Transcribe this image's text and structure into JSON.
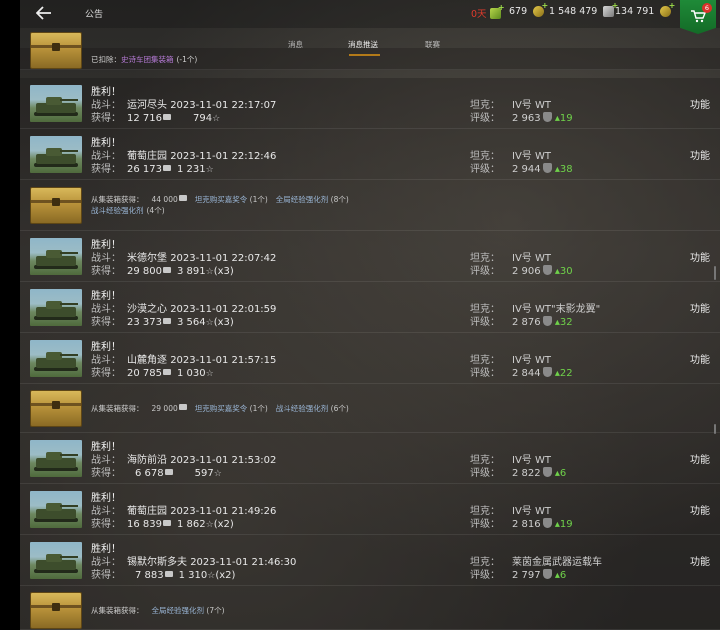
{
  "header": {
    "title": "公告",
    "gold": "0天",
    "gold_amount": "679",
    "silver": "1 548 479",
    "free_xp": "134 791",
    "shop_badge": "6"
  },
  "tabs": [
    {
      "label": "消息"
    },
    {
      "label": "消息推送"
    },
    {
      "label": "联赛"
    }
  ],
  "partial_row": {
    "text": "已扣除：",
    "item": "史诗车团集装箱",
    "count": "(-1个)"
  },
  "rows": [
    {
      "victory": "胜利！",
      "battle_label": "战斗：",
      "map": "运河尽头",
      "datetime": "2023-11-01 22:17:07",
      "reward_label": "获得：",
      "credits": "12 716",
      "xp": "794",
      "xp_mult": "",
      "tank_label": "坦克：",
      "tank": "IV号 WT",
      "rating_label": "评级：",
      "rating": "2 963",
      "delta": "19",
      "action": "功能"
    },
    {
      "victory": "胜利！",
      "battle_label": "战斗：",
      "map": "葡萄庄园",
      "datetime": "2023-11-01 22:12:46",
      "reward_label": "获得：",
      "credits": "26 173",
      "xp": "1 231",
      "xp_mult": "",
      "tank_label": "坦克：",
      "tank": "IV号 WT",
      "rating_label": "评级：",
      "rating": "2 944",
      "delta": "38",
      "action": "功能"
    },
    {
      "victory": "胜利！",
      "battle_label": "战斗：",
      "map": "米德尔堡",
      "datetime": "2023-11-01 22:07:42",
      "reward_label": "获得：",
      "credits": "29 800",
      "xp": "3 891",
      "xp_mult": "(x3)",
      "tank_label": "坦克：",
      "tank": "IV号 WT",
      "rating_label": "评级：",
      "rating": "2 906",
      "delta": "30",
      "action": "功能"
    },
    {
      "victory": "胜利！",
      "battle_label": "战斗：",
      "map": "沙漠之心",
      "datetime": "2023-11-01 22:01:59",
      "reward_label": "获得：",
      "credits": "23 373",
      "xp": "3 564",
      "xp_mult": "(x3)",
      "tank_label": "坦克：",
      "tank": "IV号 WT\"末影龙翼\"",
      "rating_label": "评级：",
      "rating": "2 876",
      "delta": "32",
      "action": "功能"
    },
    {
      "victory": "胜利！",
      "battle_label": "战斗：",
      "map": "山麓角逐",
      "datetime": "2023-11-01 21:57:15",
      "reward_label": "获得：",
      "credits": "20 785",
      "xp": "1 030",
      "xp_mult": "",
      "tank_label": "坦克：",
      "tank": "IV号 WT",
      "rating_label": "评级：",
      "rating": "2 844",
      "delta": "22",
      "action": "功能"
    },
    {
      "victory": "胜利！",
      "battle_label": "战斗：",
      "map": "海防前沿",
      "datetime": "2023-11-01 21:53:02",
      "reward_label": "获得：",
      "credits": "6 678",
      "xp": "597",
      "xp_mult": "",
      "tank_label": "坦克：",
      "tank": "IV号 WT",
      "rating_label": "评级：",
      "rating": "2 822",
      "delta": "6",
      "action": "功能"
    },
    {
      "victory": "胜利！",
      "battle_label": "战斗：",
      "map": "葡萄庄园",
      "datetime": "2023-11-01 21:49:26",
      "reward_label": "获得：",
      "credits": "16 839",
      "xp": "1 862",
      "xp_mult": "(x2)",
      "tank_label": "坦克：",
      "tank": "IV号 WT",
      "rating_label": "评级：",
      "rating": "2 816",
      "delta": "19",
      "action": "功能"
    },
    {
      "victory": "胜利！",
      "battle_label": "战斗：",
      "map": "锡默尔斯多夫",
      "datetime": "2023-11-01 21:46:30",
      "reward_label": "获得：",
      "credits": "7 883",
      "xp": "1 310",
      "xp_mult": "(x2)",
      "tank_label": "坦克：",
      "tank": "莱茵金属武器运载车",
      "rating_label": "评级：",
      "rating": "2 797",
      "delta": "6",
      "action": "功能"
    }
  ],
  "chest_rows": [
    {
      "prefix": "从集装箱获得：",
      "credits": "44 000",
      "item1": "坦克购买嘉奖令",
      "count1": "(1个)",
      "item2": "全局经验强化剂",
      "count2": "(8个)",
      "line2_item": "战斗经验强化剂",
      "line2_count": "(4个)"
    },
    {
      "prefix": "从集装箱获得：",
      "credits": "29 000",
      "item1": "坦克购买嘉奖令",
      "count1": "(1个)",
      "item2": "战斗经验强化剂",
      "count2": "(6个)"
    },
    {
      "prefix": "从集装箱获得：",
      "item1": "全局经验强化剂",
      "count1": "(7个)"
    }
  ]
}
